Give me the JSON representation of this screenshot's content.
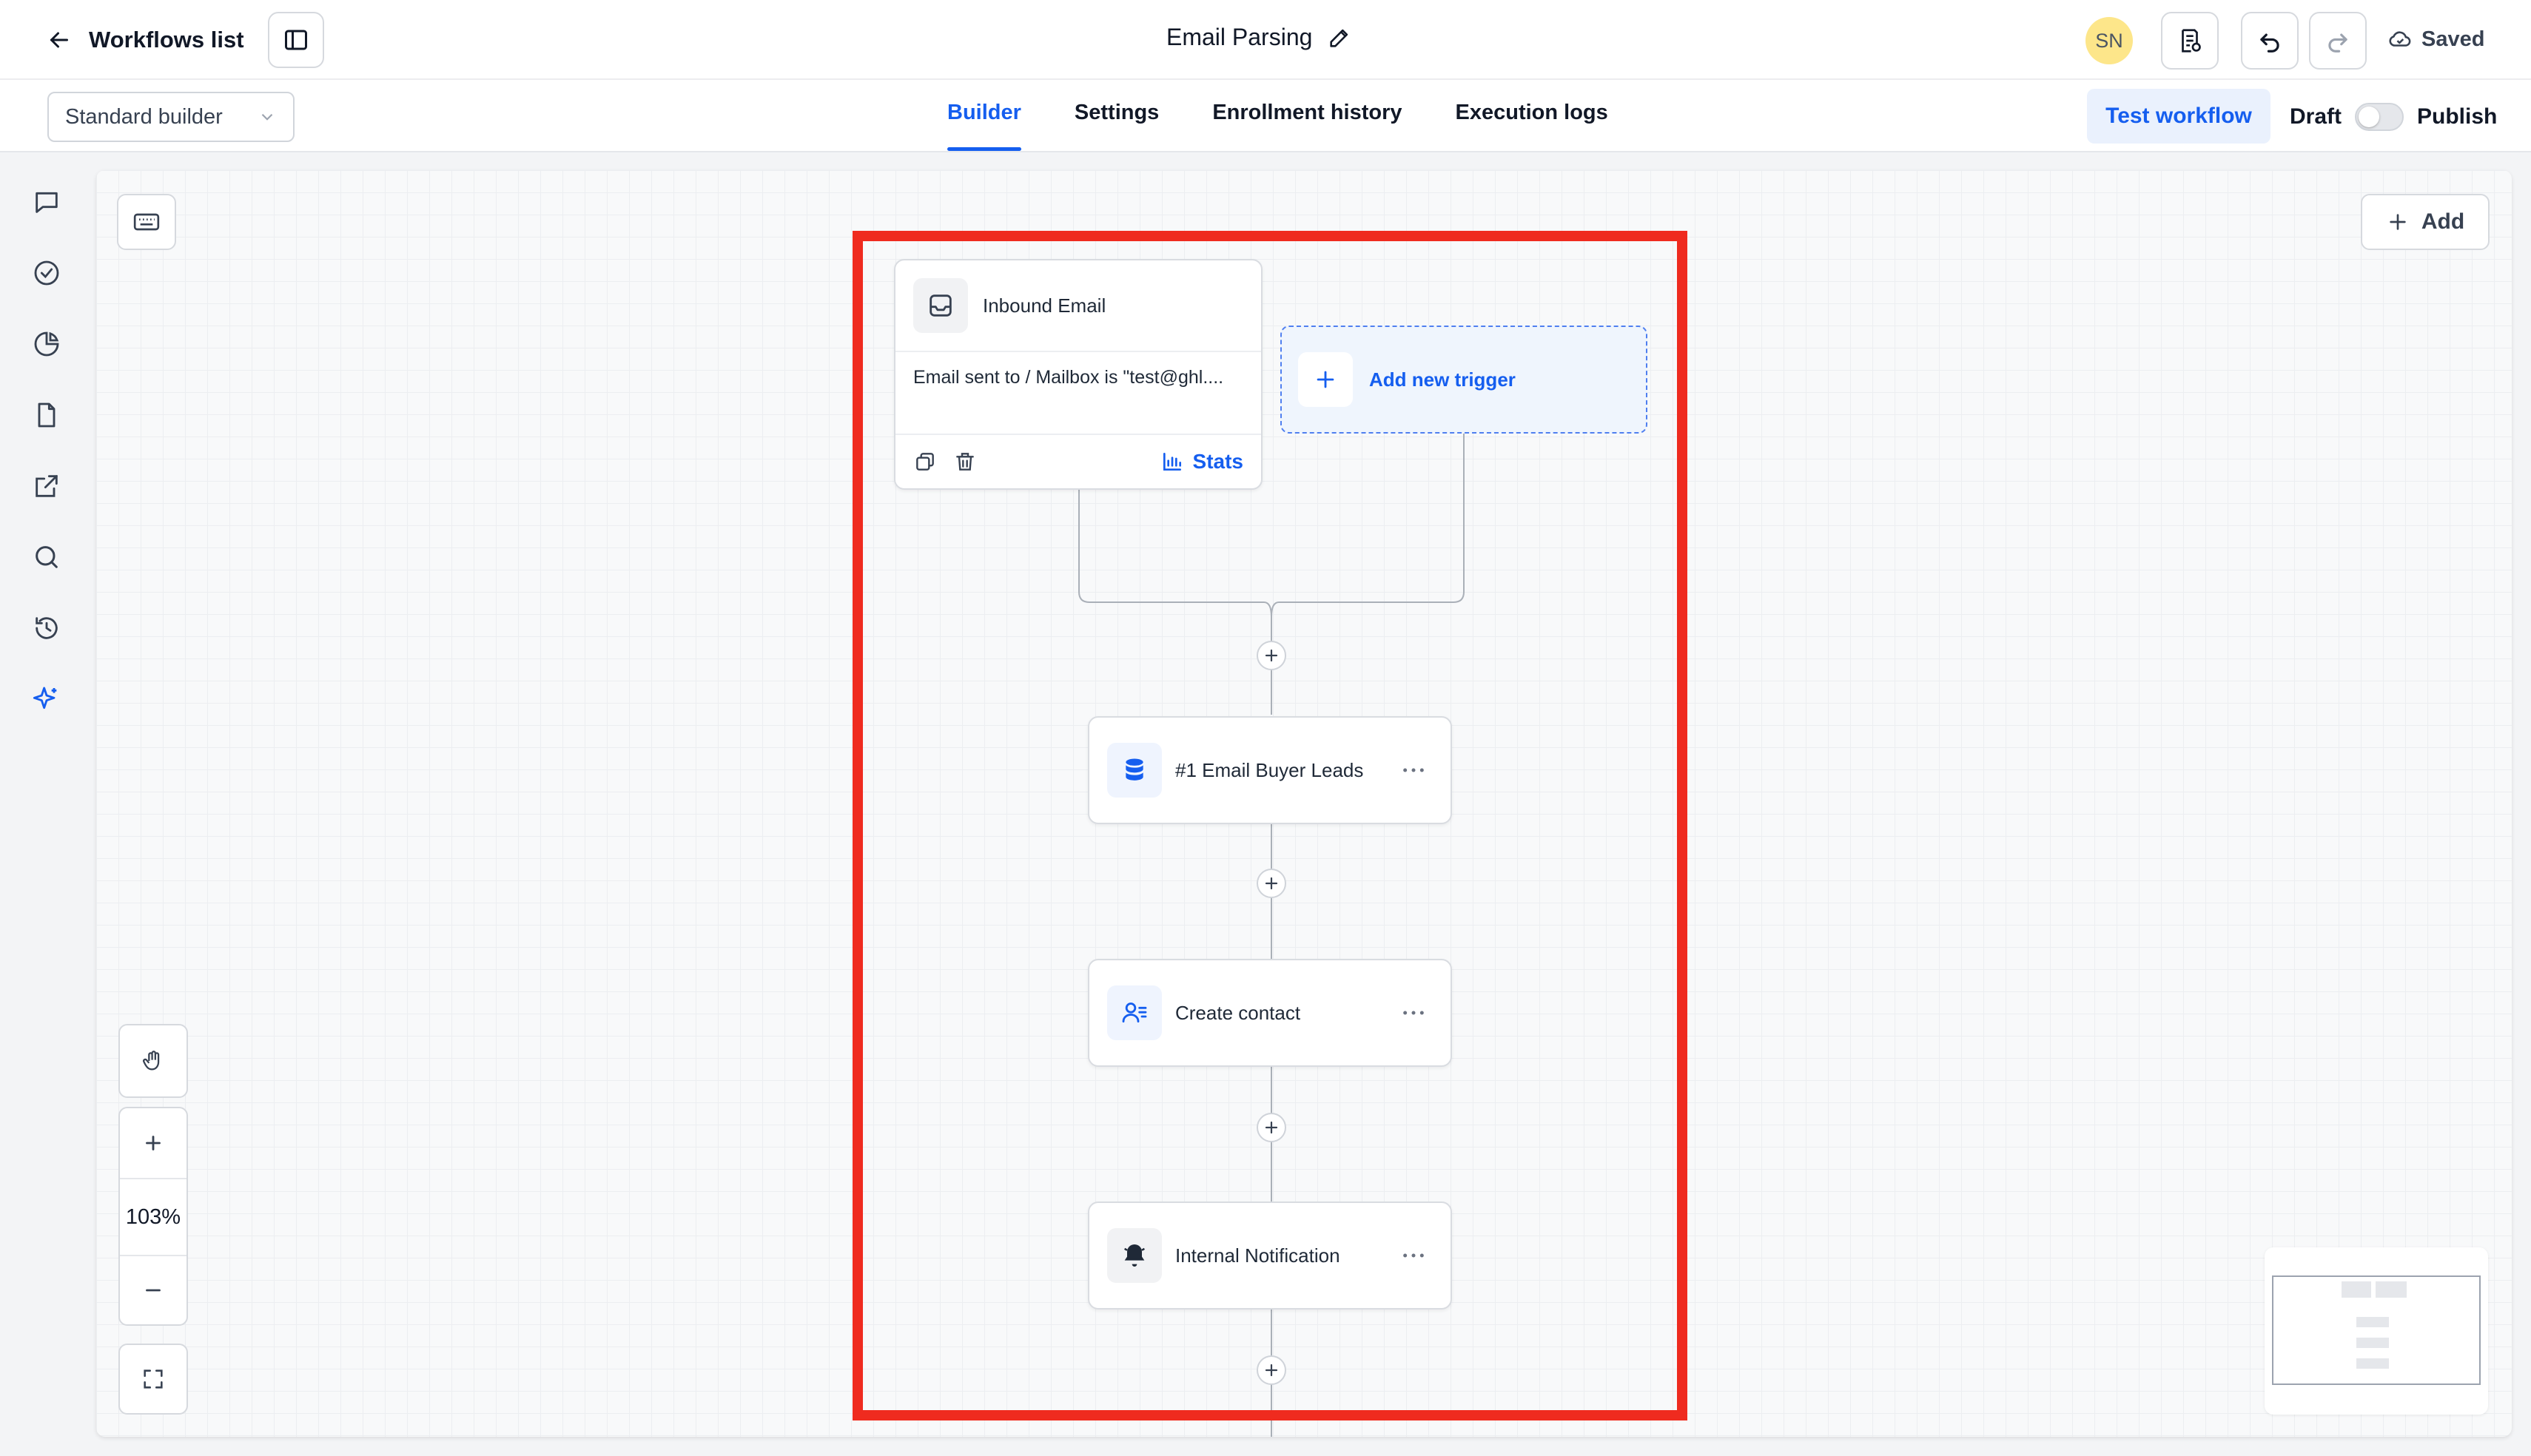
{
  "header": {
    "back_label": "Workflows list",
    "title": "Email Parsing",
    "avatar_initials": "SN",
    "saved_label": "Saved"
  },
  "subbar": {
    "builder_select": "Standard builder",
    "tabs": [
      {
        "label": "Builder",
        "active": true
      },
      {
        "label": "Settings",
        "active": false
      },
      {
        "label": "Enrollment history",
        "active": false
      },
      {
        "label": "Execution logs",
        "active": false
      }
    ],
    "test_button": "Test workflow",
    "draft_label": "Draft",
    "publish_label": "Publish",
    "publish_enabled": false
  },
  "left_rail": {
    "icons": [
      "chat-icon",
      "check-circle-icon",
      "pie-chart-icon",
      "file-icon",
      "external-link-icon",
      "search-icon",
      "history-icon",
      "sparkle-icon"
    ]
  },
  "canvas": {
    "add_label": "Add",
    "zoom_level": "103%",
    "trigger": {
      "title": "Inbound Email",
      "condition": "Email sent to / Mailbox is \"test@ghl....",
      "stats_label": "Stats"
    },
    "add_trigger_label": "Add new trigger",
    "actions": [
      {
        "label": "#1 Email Buyer Leads",
        "icon": "database-icon"
      },
      {
        "label": "Create contact",
        "icon": "user-list-icon"
      },
      {
        "label": "Internal Notification",
        "icon": "bell-icon"
      }
    ]
  },
  "colors": {
    "accent": "#155eef",
    "highlight": "#ef2b1f",
    "avatar_bg": "#fde68a"
  }
}
